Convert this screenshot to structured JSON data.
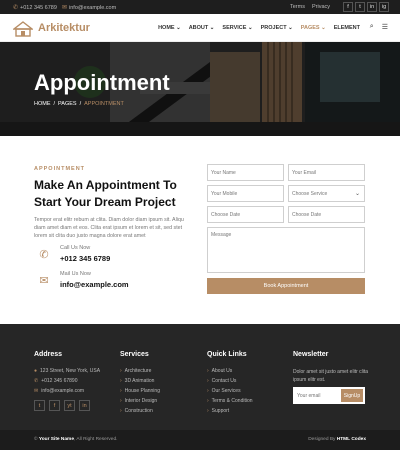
{
  "topbar": {
    "phone": "+012 345 6789",
    "email": "info@example.com",
    "links": [
      "Terms",
      "Privacy"
    ],
    "social": [
      "f",
      "t",
      "in",
      "ig"
    ]
  },
  "nav": {
    "brand": "Arkitektur",
    "menu": [
      {
        "label": "HOME",
        "chevron": true
      },
      {
        "label": "ABOUT",
        "chevron": true
      },
      {
        "label": "SERVICE",
        "chevron": true
      },
      {
        "label": "PROJECT",
        "chevron": true
      },
      {
        "label": "PAGES",
        "chevron": true,
        "active": true
      },
      {
        "label": "ELEMENT",
        "chevron": false
      }
    ]
  },
  "hero": {
    "title": "Appointment",
    "breadcrumb": [
      "HOME",
      "PAGES",
      "APPOINTMENT"
    ]
  },
  "appointment": {
    "subtitle": "APPOINTMENT",
    "title": "Make An Appointment To Start Your Dream Project",
    "description": "Tempor erat elitr rebum at clita. Diam dolor diam ipsum sit. Aliqu diam amet diam et eos. Clita erat ipsum et lorem et sit, sed stet lorem sit clita duo justo magna dolore erat amet",
    "call_label": "Call Us Now",
    "call_value": "+012 345 6789",
    "mail_label": "Mail Us Now",
    "mail_value": "info@example.com"
  },
  "form": {
    "name": "Your Name",
    "email": "Your Email",
    "mobile": "Your Mobile",
    "service": "Choose Service",
    "date": "Choose Date",
    "time": "Choose Date",
    "message": "Message",
    "submit": "Book Appointment"
  },
  "footer": {
    "address": {
      "heading": "Address",
      "lines": [
        "123 Street, New York, USA",
        "+012 345 67890",
        "info@example.com"
      ],
      "social": [
        "t",
        "f",
        "yt",
        "in"
      ]
    },
    "services": {
      "heading": "Services",
      "items": [
        "Architecture",
        "3D Animation",
        "House Planning",
        "Interior Design",
        "Construction"
      ]
    },
    "quick_links": {
      "heading": "Quick Links",
      "items": [
        "About Us",
        "Contact Us",
        "Our Services",
        "Terms & Condition",
        "Support"
      ]
    },
    "newsletter": {
      "heading": "Newsletter",
      "text": "Dolor amet sit justo amet elitr clita ipsum elitr est.",
      "placeholder": "Your email",
      "button": "SignUp"
    }
  },
  "copyright": {
    "prefix": "©",
    "site": "Your Site Name",
    "suffix": ", All Right Reserved.",
    "designed_prefix": "Designed By",
    "designer": "HTML Codex"
  }
}
